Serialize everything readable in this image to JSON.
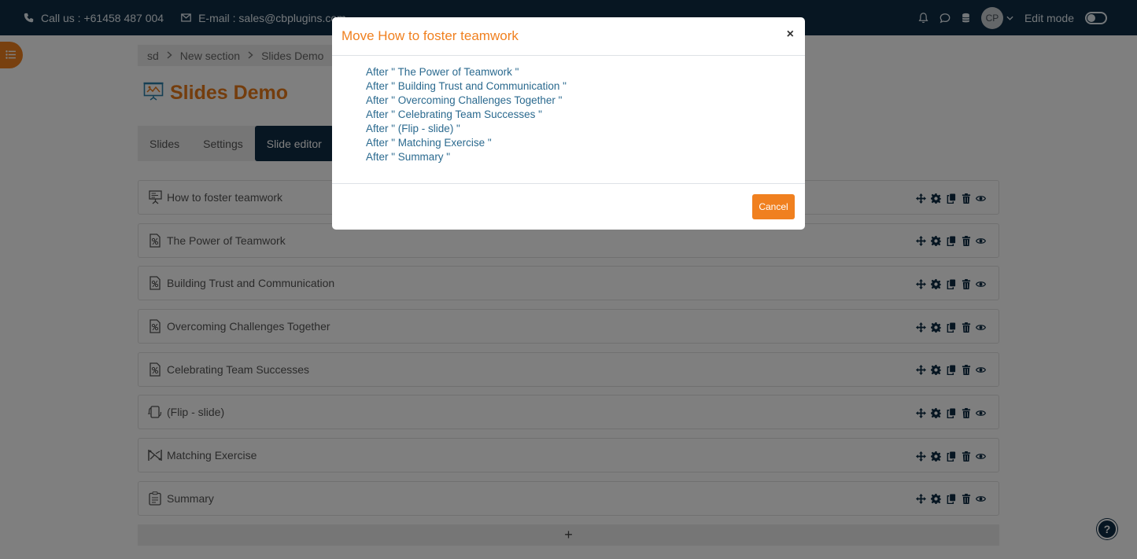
{
  "header": {
    "phone_text": "Call us : +61458 487 004",
    "email_text": "E-mail : sales@cbplugins.com",
    "avatar_initials": "CP",
    "edit_mode_label": "Edit mode",
    "edit_mode_on": false
  },
  "breadcrumb": {
    "items": [
      "sd",
      "New section",
      "Slides Demo"
    ]
  },
  "page": {
    "title": "Slides Demo",
    "tabs": [
      {
        "label": "Slides",
        "active": false
      },
      {
        "label": "Settings",
        "active": false
      },
      {
        "label": "Slide editor",
        "active": true
      }
    ]
  },
  "slides": [
    {
      "label": "How to foster teamwork",
      "icon": "presentation-icon"
    },
    {
      "label": "The Power of Teamwork",
      "icon": "slide-doc-icon"
    },
    {
      "label": "Building Trust and Communication",
      "icon": "slide-doc-icon"
    },
    {
      "label": "Overcoming Challenges Together",
      "icon": "slide-doc-icon"
    },
    {
      "label": "Celebrating Team Successes",
      "icon": "slide-doc-icon"
    },
    {
      "label": "(Flip - slide)",
      "icon": "flip-icon"
    },
    {
      "label": "Matching Exercise",
      "icon": "matching-icon"
    },
    {
      "label": "Summary",
      "icon": "summary-icon"
    }
  ],
  "add_button_label": "+",
  "help_label": "?",
  "modal": {
    "title": "Move How to foster teamwork",
    "close_label": "×",
    "options": [
      "After \" The Power of Teamwork \"",
      "After \" Building Trust and Communication \"",
      "After \" Overcoming Challenges Together \"",
      "After \" Celebrating Team Successes \"",
      "After \" (Flip - slide) \"",
      "After \" Matching Exercise \"",
      "After \" Summary \""
    ],
    "cancel_label": "Cancel"
  },
  "colors": {
    "navbar": "#0f2d44",
    "accent": "#f0801f",
    "link": "#2b6a8f"
  }
}
